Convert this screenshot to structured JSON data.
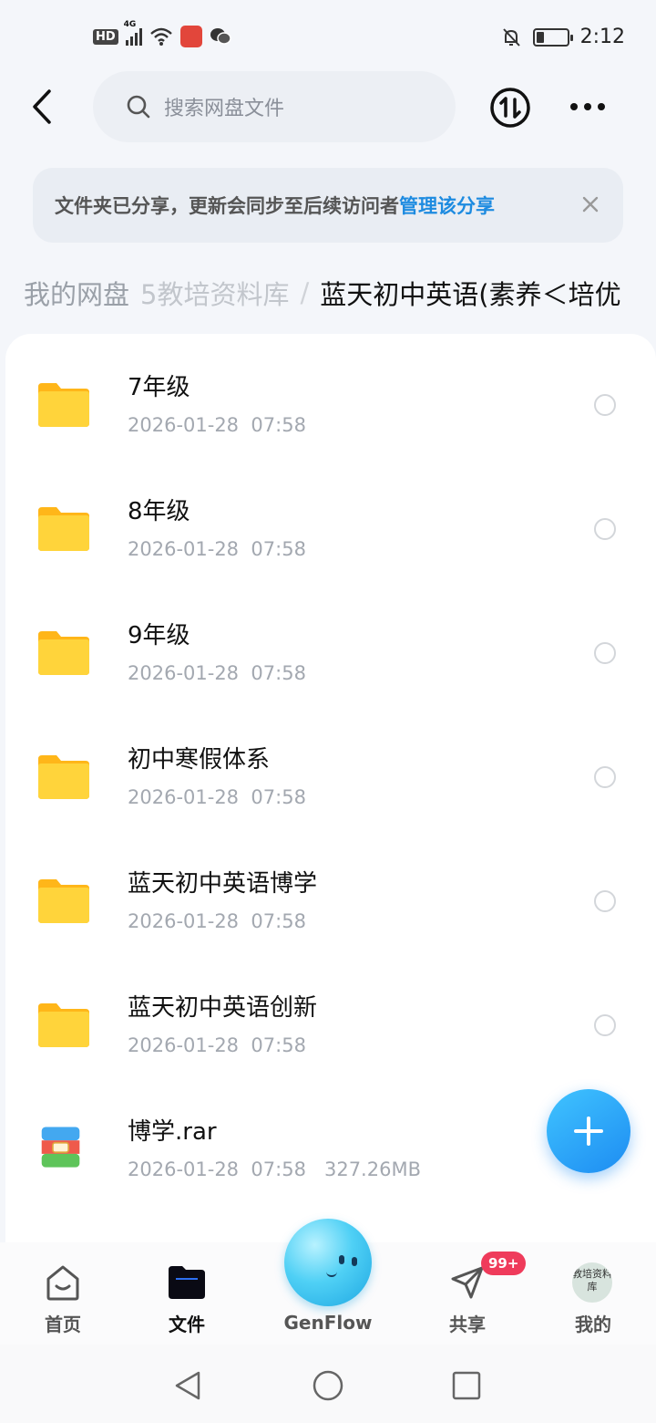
{
  "status_bar": {
    "network_badge": "HD",
    "network_type": "4G",
    "time": "2:12"
  },
  "search": {
    "placeholder": "搜索网盘文件"
  },
  "banner": {
    "message": "文件夹已分享，更新会同步至后续访问者",
    "action": "管理该分享"
  },
  "breadcrumb": {
    "root": "我的网盘",
    "middle": "5教培资料库",
    "separator": "/",
    "current": "蓝天初中英语(素养＜培优"
  },
  "files": [
    {
      "name": "7年级",
      "date": "2026-01-28",
      "time": "07:58",
      "size": "",
      "type": "folder"
    },
    {
      "name": "8年级",
      "date": "2026-01-28",
      "time": "07:58",
      "size": "",
      "type": "folder"
    },
    {
      "name": "9年级",
      "date": "2026-01-28",
      "time": "07:58",
      "size": "",
      "type": "folder"
    },
    {
      "name": "初中寒假体系",
      "date": "2026-01-28",
      "time": "07:58",
      "size": "",
      "type": "folder"
    },
    {
      "name": "蓝天初中英语博学",
      "date": "2026-01-28",
      "time": "07:58",
      "size": "",
      "type": "folder"
    },
    {
      "name": "蓝天初中英语创新",
      "date": "2026-01-28",
      "time": "07:58",
      "size": "",
      "type": "folder"
    },
    {
      "name": "博学.rar",
      "date": "2026-01-28",
      "time": "07:58",
      "size": "327.26MB",
      "type": "archive"
    }
  ],
  "bottom_nav": {
    "home": "首页",
    "files": "文件",
    "genflow": "GenFlow",
    "share": "共享",
    "share_badge": "99+",
    "mine": "我的",
    "avatar_text": "教培资料库"
  },
  "colors": {
    "accent": "#1d8be0",
    "folder": "#ffc928",
    "badge": "#ef3b5b"
  },
  "icons": {
    "back": "back-arrow-icon",
    "search": "search-icon",
    "transfer": "transfer-icon",
    "more": "more-icon",
    "close": "close-icon",
    "folder": "folder-icon",
    "archive": "archive-icon",
    "add": "plus-icon"
  }
}
